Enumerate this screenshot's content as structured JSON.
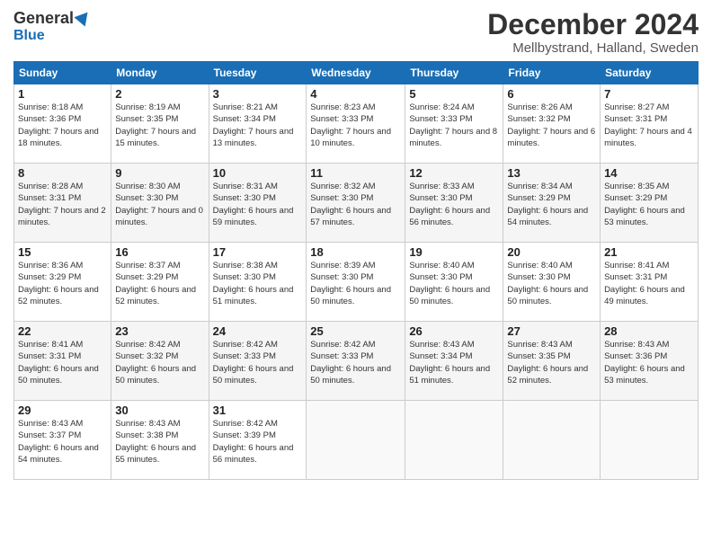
{
  "header": {
    "logo_general": "General",
    "logo_blue": "Blue",
    "month_title": "December 2024",
    "location": "Mellbystrand, Halland, Sweden"
  },
  "weekdays": [
    "Sunday",
    "Monday",
    "Tuesday",
    "Wednesday",
    "Thursday",
    "Friday",
    "Saturday"
  ],
  "weeks": [
    [
      {
        "day": "1",
        "sunrise": "8:18 AM",
        "sunset": "3:36 PM",
        "daylight": "7 hours and 18 minutes."
      },
      {
        "day": "2",
        "sunrise": "8:19 AM",
        "sunset": "3:35 PM",
        "daylight": "7 hours and 15 minutes."
      },
      {
        "day": "3",
        "sunrise": "8:21 AM",
        "sunset": "3:34 PM",
        "daylight": "7 hours and 13 minutes."
      },
      {
        "day": "4",
        "sunrise": "8:23 AM",
        "sunset": "3:33 PM",
        "daylight": "7 hours and 10 minutes."
      },
      {
        "day": "5",
        "sunrise": "8:24 AM",
        "sunset": "3:33 PM",
        "daylight": "7 hours and 8 minutes."
      },
      {
        "day": "6",
        "sunrise": "8:26 AM",
        "sunset": "3:32 PM",
        "daylight": "7 hours and 6 minutes."
      },
      {
        "day": "7",
        "sunrise": "8:27 AM",
        "sunset": "3:31 PM",
        "daylight": "7 hours and 4 minutes."
      }
    ],
    [
      {
        "day": "8",
        "sunrise": "8:28 AM",
        "sunset": "3:31 PM",
        "daylight": "7 hours and 2 minutes."
      },
      {
        "day": "9",
        "sunrise": "8:30 AM",
        "sunset": "3:30 PM",
        "daylight": "7 hours and 0 minutes."
      },
      {
        "day": "10",
        "sunrise": "8:31 AM",
        "sunset": "3:30 PM",
        "daylight": "6 hours and 59 minutes."
      },
      {
        "day": "11",
        "sunrise": "8:32 AM",
        "sunset": "3:30 PM",
        "daylight": "6 hours and 57 minutes."
      },
      {
        "day": "12",
        "sunrise": "8:33 AM",
        "sunset": "3:30 PM",
        "daylight": "6 hours and 56 minutes."
      },
      {
        "day": "13",
        "sunrise": "8:34 AM",
        "sunset": "3:29 PM",
        "daylight": "6 hours and 54 minutes."
      },
      {
        "day": "14",
        "sunrise": "8:35 AM",
        "sunset": "3:29 PM",
        "daylight": "6 hours and 53 minutes."
      }
    ],
    [
      {
        "day": "15",
        "sunrise": "8:36 AM",
        "sunset": "3:29 PM",
        "daylight": "6 hours and 52 minutes."
      },
      {
        "day": "16",
        "sunrise": "8:37 AM",
        "sunset": "3:29 PM",
        "daylight": "6 hours and 52 minutes."
      },
      {
        "day": "17",
        "sunrise": "8:38 AM",
        "sunset": "3:30 PM",
        "daylight": "6 hours and 51 minutes."
      },
      {
        "day": "18",
        "sunrise": "8:39 AM",
        "sunset": "3:30 PM",
        "daylight": "6 hours and 50 minutes."
      },
      {
        "day": "19",
        "sunrise": "8:40 AM",
        "sunset": "3:30 PM",
        "daylight": "6 hours and 50 minutes."
      },
      {
        "day": "20",
        "sunrise": "8:40 AM",
        "sunset": "3:30 PM",
        "daylight": "6 hours and 50 minutes."
      },
      {
        "day": "21",
        "sunrise": "8:41 AM",
        "sunset": "3:31 PM",
        "daylight": "6 hours and 49 minutes."
      }
    ],
    [
      {
        "day": "22",
        "sunrise": "8:41 AM",
        "sunset": "3:31 PM",
        "daylight": "6 hours and 50 minutes."
      },
      {
        "day": "23",
        "sunrise": "8:42 AM",
        "sunset": "3:32 PM",
        "daylight": "6 hours and 50 minutes."
      },
      {
        "day": "24",
        "sunrise": "8:42 AM",
        "sunset": "3:33 PM",
        "daylight": "6 hours and 50 minutes."
      },
      {
        "day": "25",
        "sunrise": "8:42 AM",
        "sunset": "3:33 PM",
        "daylight": "6 hours and 50 minutes."
      },
      {
        "day": "26",
        "sunrise": "8:43 AM",
        "sunset": "3:34 PM",
        "daylight": "6 hours and 51 minutes."
      },
      {
        "day": "27",
        "sunrise": "8:43 AM",
        "sunset": "3:35 PM",
        "daylight": "6 hours and 52 minutes."
      },
      {
        "day": "28",
        "sunrise": "8:43 AM",
        "sunset": "3:36 PM",
        "daylight": "6 hours and 53 minutes."
      }
    ],
    [
      {
        "day": "29",
        "sunrise": "8:43 AM",
        "sunset": "3:37 PM",
        "daylight": "6 hours and 54 minutes."
      },
      {
        "day": "30",
        "sunrise": "8:43 AM",
        "sunset": "3:38 PM",
        "daylight": "6 hours and 55 minutes."
      },
      {
        "day": "31",
        "sunrise": "8:42 AM",
        "sunset": "3:39 PM",
        "daylight": "6 hours and 56 minutes."
      },
      null,
      null,
      null,
      null
    ]
  ]
}
